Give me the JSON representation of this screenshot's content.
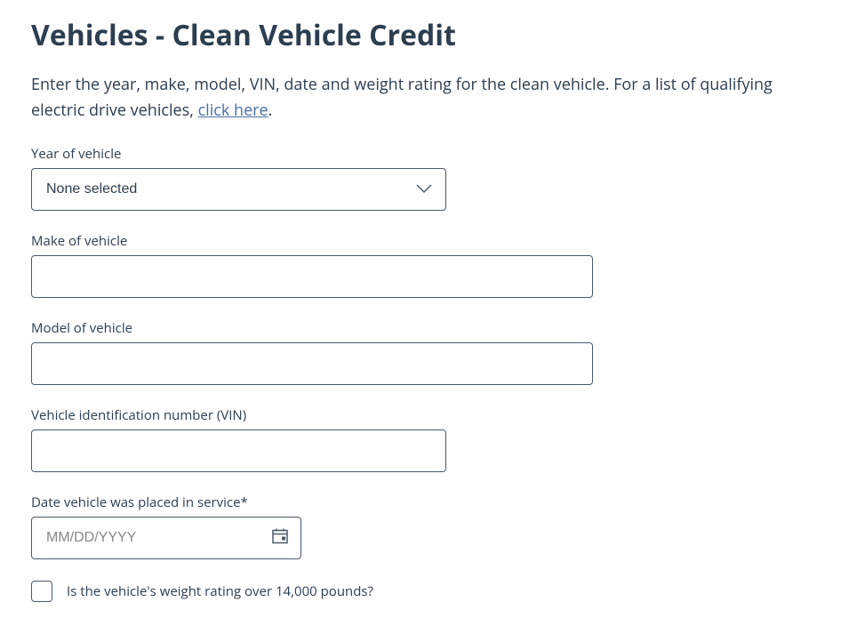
{
  "title": "Vehicles - Clean Vehicle Credit",
  "intro": {
    "text_before": "Enter the year, make, model, VIN, date and weight rating for the clean vehicle. For a list of qualifying electric drive vehicles, ",
    "link_text": "click here",
    "text_after": "."
  },
  "form": {
    "year": {
      "label": "Year of vehicle",
      "selected": "None selected"
    },
    "make": {
      "label": "Make of vehicle",
      "value": ""
    },
    "model": {
      "label": "Model of vehicle",
      "value": ""
    },
    "vin": {
      "label": "Vehicle identification number (VIN)",
      "value": ""
    },
    "date_in_service": {
      "label": "Date vehicle was placed in service*",
      "placeholder": "MM/DD/YYYY",
      "value": ""
    },
    "weight_rating": {
      "label": "Is the vehicle's weight rating over 14,000 pounds?",
      "checked": false
    }
  }
}
